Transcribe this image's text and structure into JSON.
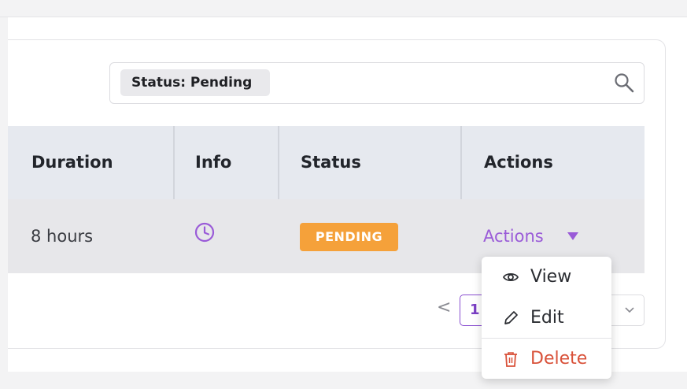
{
  "search": {
    "filter_chip": "Status: Pending"
  },
  "table": {
    "headers": [
      "Duration",
      "Info",
      "Status",
      "Actions"
    ],
    "rows": [
      {
        "duration": "8 hours",
        "info_icon": "clock-icon",
        "status": "PENDING",
        "actions_label": "Actions"
      }
    ]
  },
  "pagination": {
    "prev": "<",
    "current_page": "1"
  },
  "actions_menu": {
    "items": [
      {
        "label": "View",
        "icon": "eye-icon"
      },
      {
        "label": "Edit",
        "icon": "pencil-icon"
      },
      {
        "label": "Delete",
        "icon": "trash-icon"
      }
    ]
  },
  "colors": {
    "accent": "#9a5bd8",
    "pending": "#f5a13a",
    "danger": "#d9523a"
  }
}
